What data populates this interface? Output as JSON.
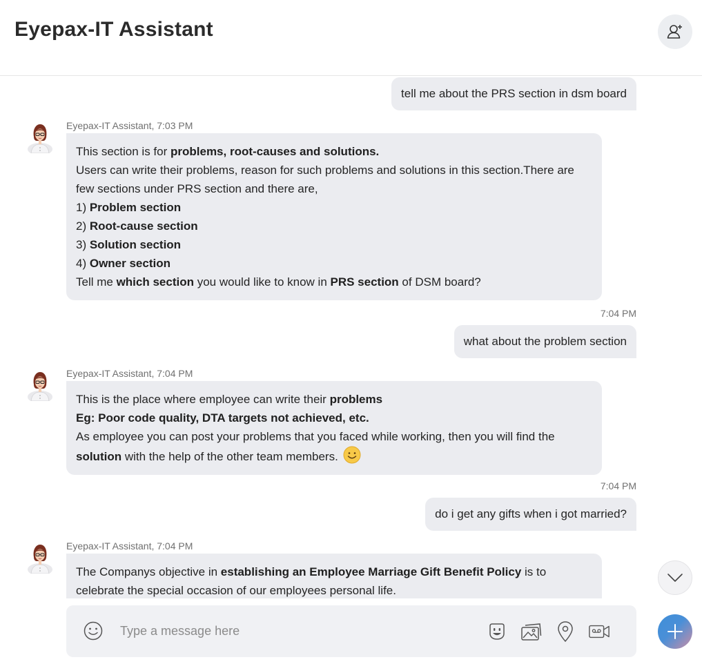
{
  "header": {
    "title": "Eyepax-IT Assistant",
    "add_person_icon": "add-person-icon"
  },
  "messages": {
    "m1": {
      "direction": "out",
      "text": "tell me about the PRS section in dsm board"
    },
    "m2": {
      "direction": "in",
      "sender": "Eyepax-IT Assistant, 7:03 PM",
      "l1a": "This section is for ",
      "l1b": "problems, root-causes and solutions.",
      "l2": "Users can write their problems, reason for such problems and solutions in this section.There are few sections under PRS section and there are,",
      "i1n": "1) ",
      "i1": "Problem section",
      "i2n": "2) ",
      "i2": "Root-cause section",
      "i3n": "3) ",
      "i3": "Solution section",
      "i4n": "4) ",
      "i4": "Owner section",
      "l7a": "Tell me ",
      "l7b": "which section",
      "l7c": " you would like to know in ",
      "l7d": "PRS section",
      "l7e": " of DSM board?"
    },
    "m3": {
      "direction": "out",
      "time": "7:04 PM",
      "text": "what about the problem section"
    },
    "m4": {
      "direction": "in",
      "sender": "Eyepax-IT Assistant, 7:04 PM",
      "l1a": "This is the place where employee can write their ",
      "l1b": "problems",
      "l2": "Eg: Poor code quality, DTA targets not achieved, etc.",
      "l3": "As employee you can post your problems that you faced while working, then you will find the ",
      "l3b": "solution",
      "l3c": " with the help of the other team members. ",
      "emoji": "smiley-emoji"
    },
    "m5": {
      "direction": "out",
      "time": "7:04 PM",
      "text": "do i get any gifts when i got married?"
    },
    "m6": {
      "direction": "in",
      "sender": "Eyepax-IT Assistant, 7:04 PM",
      "l1a": "The Companys objective in ",
      "l1b": "establishing an Employee Marriage Gift Benefit Policy",
      "l1c": " is to celebrate the special occasion of our employees personal life."
    }
  },
  "composer": {
    "placeholder": "Type a message here",
    "tools": [
      "emoji-icon",
      "sticker-icon",
      "gallery-icon",
      "location-icon",
      "video-message-icon"
    ]
  },
  "controls": {
    "scroll_down_icon": "chevron-down-icon",
    "fab_icon": "plus-icon"
  },
  "colors": {
    "bubble": "#ebecf0",
    "composer": "#f0f1f4",
    "accent": "#4a8fd7"
  }
}
